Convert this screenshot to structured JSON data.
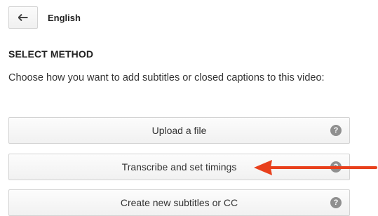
{
  "header": {
    "back_icon": "arrow-left-icon",
    "language": "English"
  },
  "section_label": "SELECT METHOD",
  "description": "Choose how you want to add subtitles or closed captions to this video:",
  "methods": [
    {
      "label": "Upload a file",
      "help_icon": "question-mark-icon",
      "help_glyph": "?"
    },
    {
      "label": "Transcribe and set timings",
      "help_icon": "question-mark-icon",
      "help_glyph": "?"
    },
    {
      "label": "Create new subtitles or CC",
      "help_icon": "question-mark-icon",
      "help_glyph": "?"
    }
  ],
  "annotation": {
    "arrow_color": "#e8401c"
  }
}
